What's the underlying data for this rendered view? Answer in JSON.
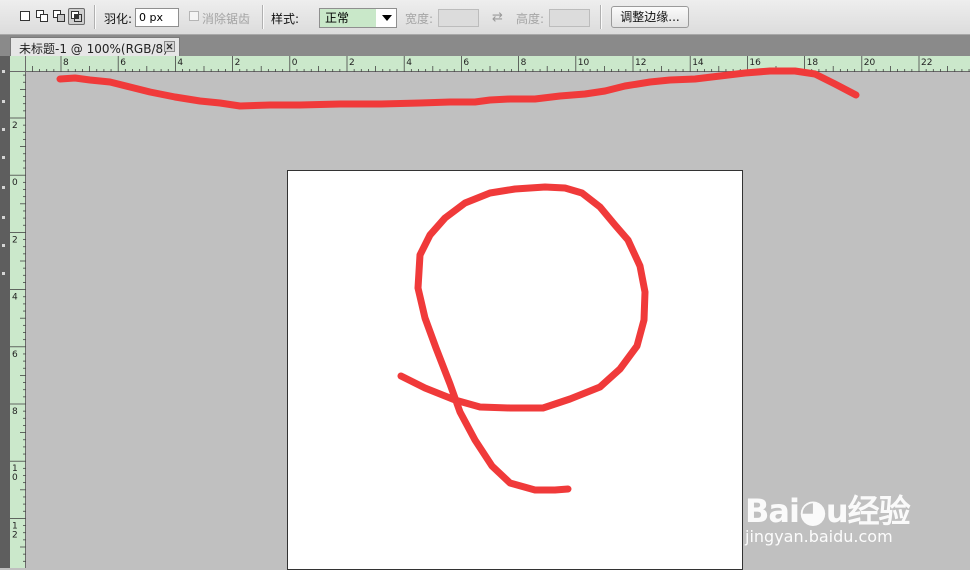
{
  "toolbar": {
    "feather_label": "羽化:",
    "feather_value": "0 px",
    "antialias_label": "消除锯齿",
    "style_label": "样式:",
    "style_value": "正常",
    "width_label": "宽度:",
    "height_label": "高度:",
    "refine_edge_label": "调整边缘...",
    "swap_icon": "⇄"
  },
  "document_tab": {
    "title": "未标题-1 @ 100%(RGB/8)"
  },
  "ruler_top": {
    "labels": [
      "8",
      "6",
      "4",
      "2",
      "0",
      "2",
      "4",
      "6",
      "8",
      "10",
      "12",
      "14",
      "16",
      "18",
      "20",
      "22"
    ]
  },
  "ruler_left": {
    "labels": [
      "2",
      "0",
      "2",
      "4",
      "6",
      "8",
      "10",
      "12"
    ]
  },
  "watermark": {
    "logo_text": "Bai◕u经验",
    "url": "jingyan.baidu.com"
  },
  "colors": {
    "brush_stroke": "#f03a3a",
    "ruler": "#cbe8cb",
    "workspace": "#c0c0c0",
    "style_highlight": "#c9e8c9"
  }
}
